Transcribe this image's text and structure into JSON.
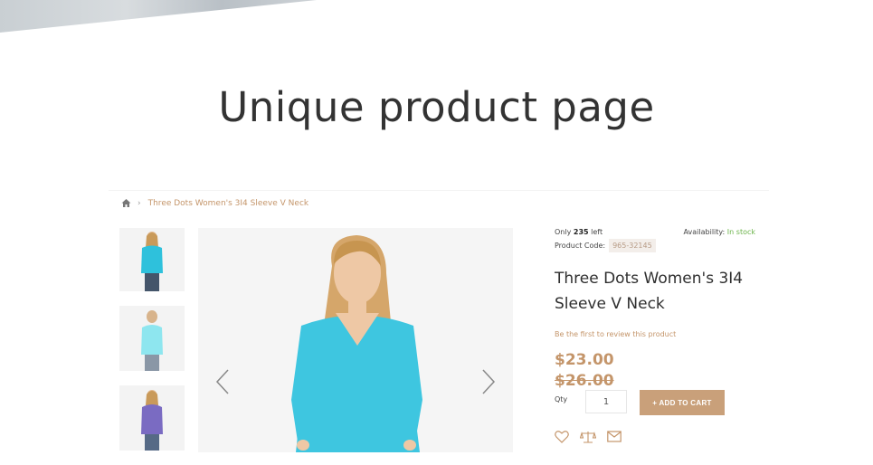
{
  "hero": {
    "title": "Unique product page"
  },
  "breadcrumb": {
    "current": "Three Dots Women's 3I4 Sleeve V Neck"
  },
  "product": {
    "stock_prefix": "Only",
    "stock_count": "235",
    "stock_suffix": "left",
    "availability_label": "Availability:",
    "availability_value": "In stock",
    "code_label": "Product Code:",
    "code_value": "965-32145",
    "name": "Three Dots Women's 3I4 Sleeve V Neck",
    "review_link": "Be the first to review this product",
    "price_now": "$23.00",
    "price_old": "$26.00",
    "qty_label": "Qty",
    "qty_value": "1",
    "add_to_cart": "+ ADD TO CART"
  },
  "gallery": {
    "thumbnail_colors": [
      "#2ec1dc",
      "#8ee6ef",
      "#7a6bc2"
    ],
    "main_color": "#3ec6e0"
  },
  "colors": {
    "accent": "#c4956a",
    "in_stock": "#6cb34a",
    "button": "#c9a07a"
  },
  "icons": [
    "home-icon",
    "chevron-left-icon",
    "chevron-right-icon",
    "heart-icon",
    "compare-icon",
    "mail-icon"
  ]
}
